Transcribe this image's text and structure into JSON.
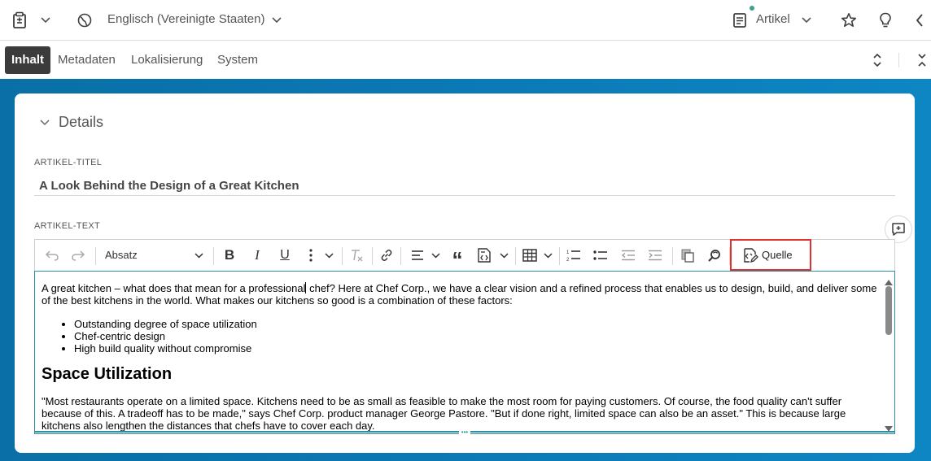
{
  "header": {
    "locale": "Englisch (Vereinigte Staaten)",
    "doctype": "Artikel"
  },
  "tabs": [
    "Inhalt",
    "Metadaten",
    "Lokalisierung",
    "System"
  ],
  "details": {
    "section_title": "Details",
    "title_label": "ARTIKEL-TITEL",
    "title_value": "A Look Behind the Design of a Great Kitchen",
    "text_label": "ARTIKEL-TEXT"
  },
  "toolbar": {
    "paragraph_style": "Absatz",
    "source_label": "Quelle"
  },
  "editor": {
    "intro_before_caret": "A great kitchen – what does that mean for a professional",
    "intro_after_caret": " chef? Here at Chef Corp., we have a clear vision and a refined process that enables us to design, build, and deliver some of the best kitchens in the world. What makes our kitchens so good is a combination of these factors:",
    "bullets": [
      "Outstanding degree of space utilization",
      "Chef-centric design",
      "High build quality without compromise"
    ],
    "heading": "Space Utilization",
    "paragraph2": "\"Most restaurants operate on a limited space. Kitchens need to be as small as feasible to make the most room for paying customers. Of course, the food quality can't suffer because of this. A tradeoff has to be made,\" says Chef Corp. product manager George Pastore. \"But if done right, limited space can also be an asset.\" This is because large kitchens also lengthen the distances that chefs have to cover each day."
  },
  "colors": {
    "accent_teal": "#2f8f9f",
    "highlight_red": "#e03030",
    "banner_blue": "#0b79b5",
    "active_tab": "#3b3b3b"
  }
}
